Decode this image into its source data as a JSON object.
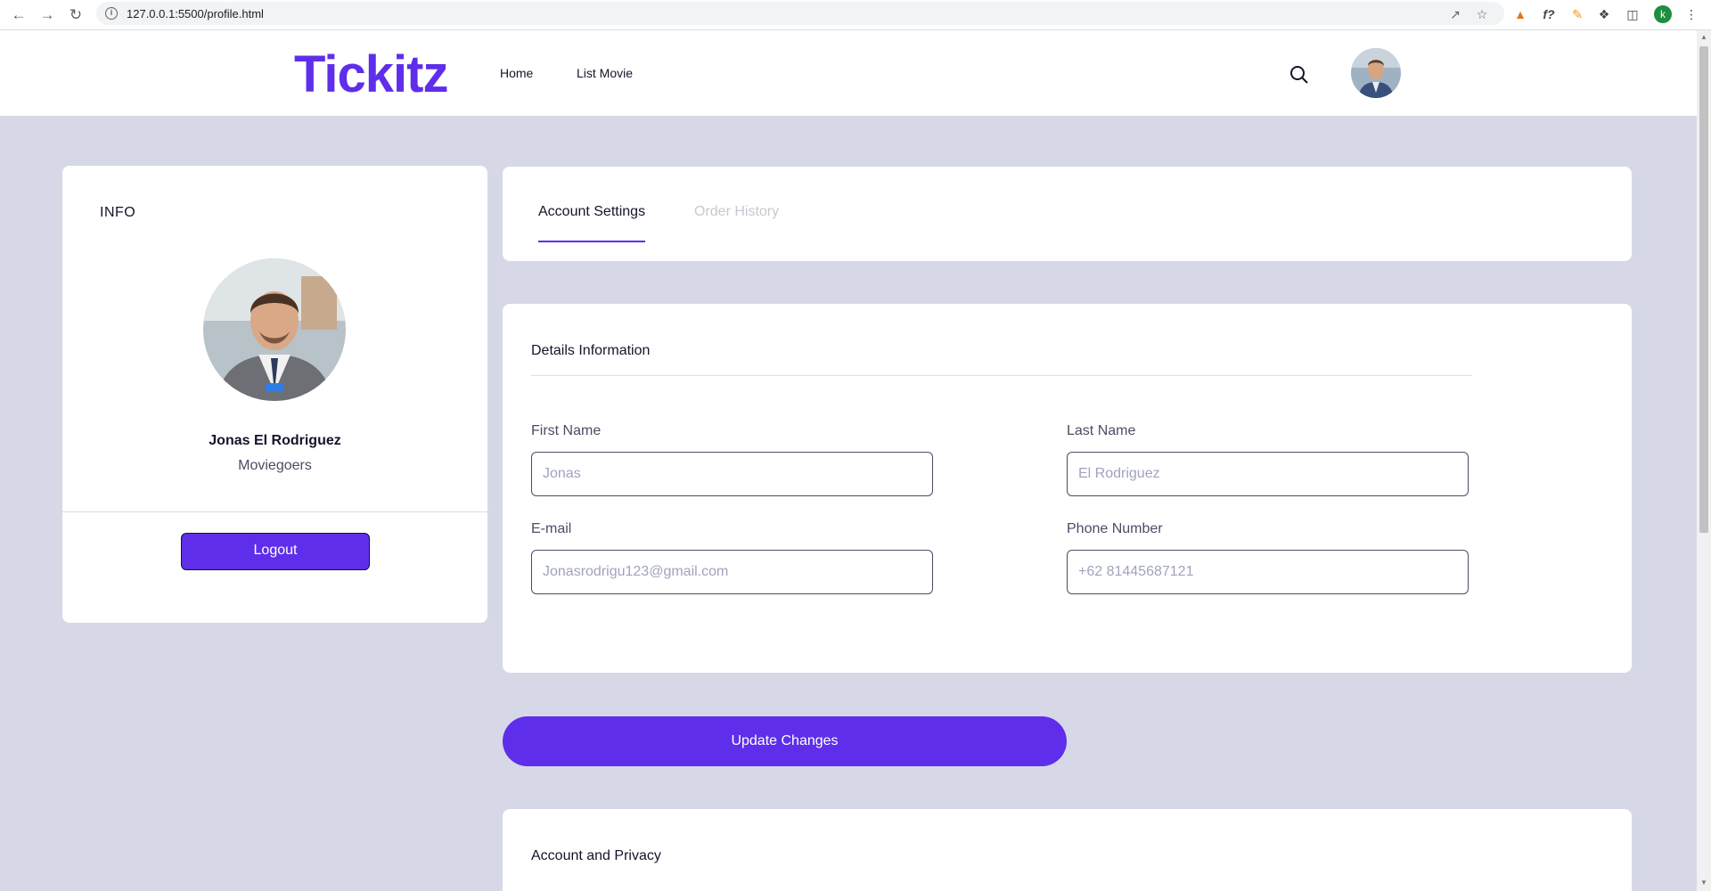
{
  "browser": {
    "url": "127.0.0.1:5500/profile.html",
    "profile_initial": "k"
  },
  "header": {
    "logo": "Tickitz",
    "nav": [
      {
        "label": "Home"
      },
      {
        "label": "List Movie"
      }
    ]
  },
  "info_card": {
    "title": "INFO",
    "name": "Jonas El Rodriguez",
    "role": "Moviegoers",
    "logout_label": "Logout"
  },
  "tabs": [
    {
      "label": "Account Settings",
      "active": true
    },
    {
      "label": "Order History",
      "active": false
    }
  ],
  "details": {
    "title": "Details Information",
    "fields": {
      "first_name": {
        "label": "First Name",
        "placeholder": "Jonas"
      },
      "last_name": {
        "label": "Last Name",
        "placeholder": "El Rodriguez"
      },
      "email": {
        "label": "E-mail",
        "placeholder": "Jonasrodrigu123@gmail.com"
      },
      "phone": {
        "label": "Phone Number",
        "placeholder": "+62 81445687121"
      }
    }
  },
  "update_label": "Update Changes",
  "privacy": {
    "title": "Account and Privacy"
  },
  "colors": {
    "accent": "#5f2eea",
    "background": "#d6d8e7"
  }
}
